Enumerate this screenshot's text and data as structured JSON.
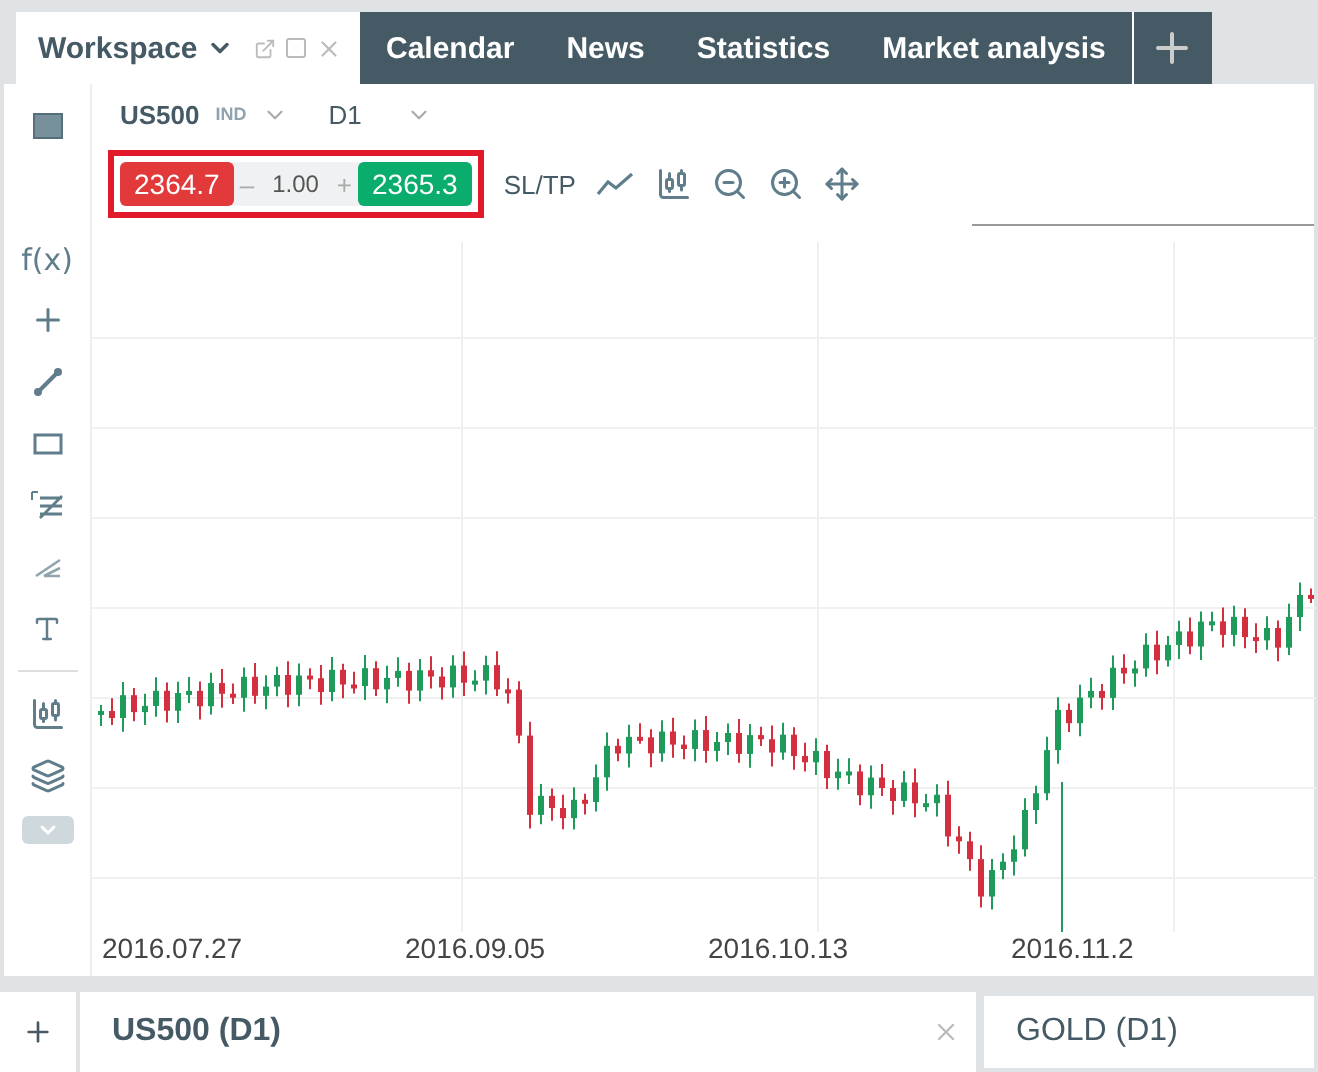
{
  "workspace": {
    "label": "Workspace"
  },
  "tabs": [
    {
      "label": "Calendar"
    },
    {
      "label": "News"
    },
    {
      "label": "Statistics"
    },
    {
      "label": "Market analysis"
    }
  ],
  "symbol": {
    "name": "US500",
    "type": "IND",
    "timeframe": "D1"
  },
  "trade": {
    "sell": "2364.7",
    "minus": "–",
    "volume": "1.00",
    "plus": "+",
    "buy": "2365.3",
    "sltp": "SL/TP"
  },
  "tools": {
    "function_label": "f(x)"
  },
  "x_labels": [
    "2016.07.27",
    "2016.09.05",
    "2016.10.13",
    "2016.11.2"
  ],
  "chart_tabs": [
    {
      "label": "US500 (D1)",
      "selected": true
    },
    {
      "label": "GOLD (D1)",
      "selected": false
    }
  ]
}
